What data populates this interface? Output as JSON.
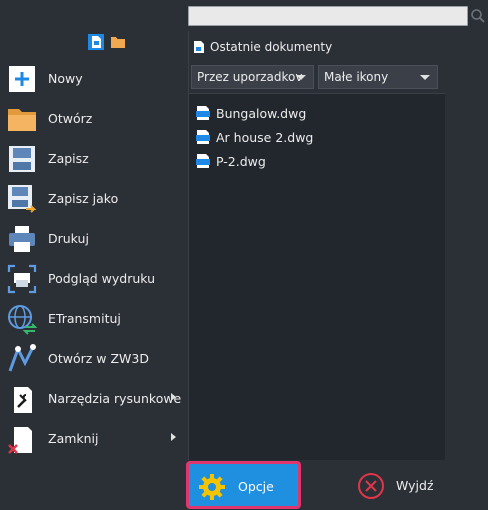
{
  "search": {
    "placeholder": "",
    "value": ""
  },
  "menu": {
    "items": [
      {
        "label": "Nowy",
        "icon": "new-icon",
        "submenu": false
      },
      {
        "label": "Otwórz",
        "icon": "folder-open-icon",
        "submenu": false
      },
      {
        "label": "Zapisz",
        "icon": "save-icon",
        "submenu": false
      },
      {
        "label": "Zapisz jako",
        "icon": "save-as-icon",
        "submenu": false
      },
      {
        "label": "Drukuj",
        "icon": "printer-icon",
        "submenu": false
      },
      {
        "label": "Podgląd wydruku",
        "icon": "print-preview-icon",
        "submenu": false
      },
      {
        "label": "ETransmituj",
        "icon": "etransmit-icon",
        "submenu": false
      },
      {
        "label": "Otwórz w ZW3D",
        "icon": "zw3d-icon",
        "submenu": false
      },
      {
        "label": "Narzędzia rysunkowe",
        "icon": "drawing-tools-icon",
        "submenu": true
      },
      {
        "label": "Zamknij",
        "icon": "close-doc-icon",
        "submenu": true
      }
    ]
  },
  "recent": {
    "title": "Ostatnie dokumenty",
    "sort_select": "Przez uporzadkov",
    "view_select": "Małe ikony",
    "files": [
      "Bungalow.dwg",
      "Ar house 2.dwg",
      "P-2.dwg"
    ]
  },
  "footer": {
    "options_label": "Opcje",
    "exit_label": "Wyjdź"
  },
  "colors": {
    "background": "#2b2f36",
    "file_area": "#22262d",
    "accent": "#1f8fe0",
    "highlight": "#e0356d"
  }
}
